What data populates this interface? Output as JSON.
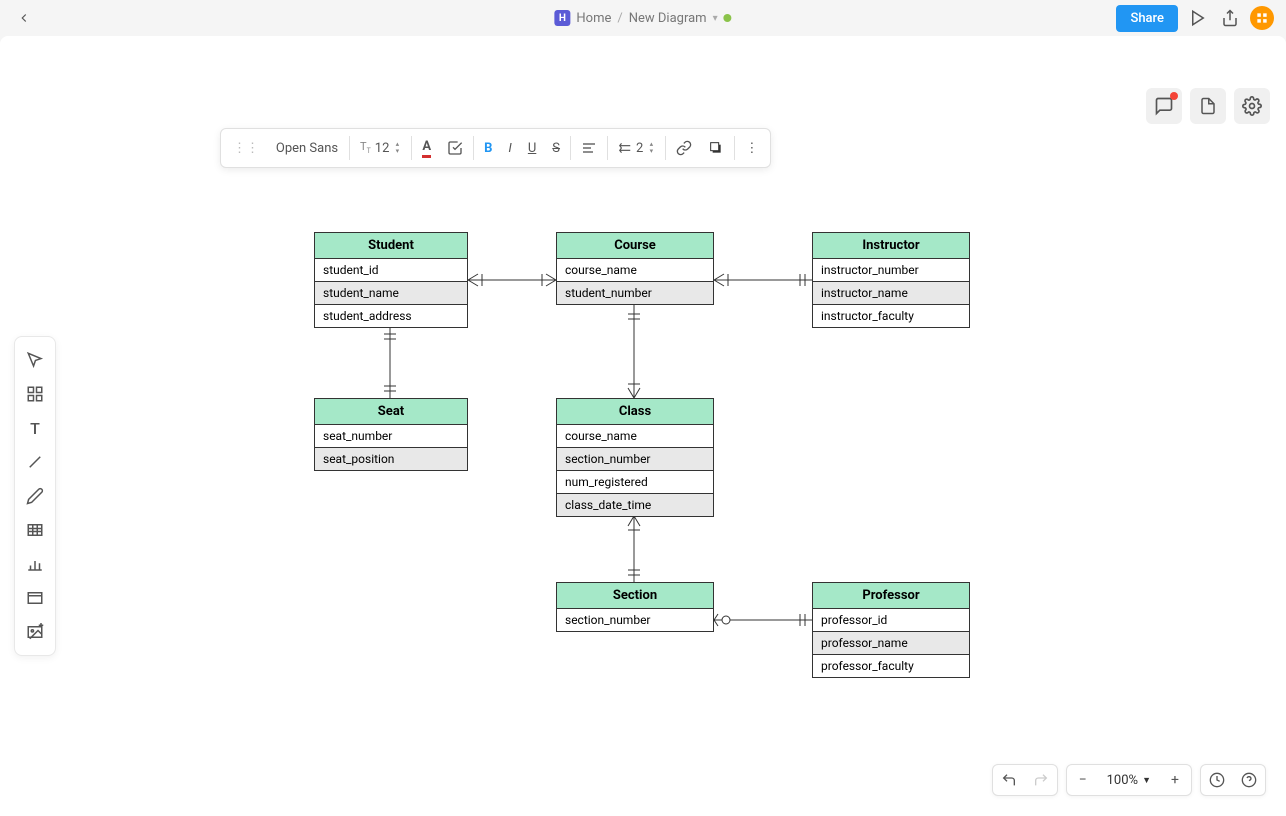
{
  "breadcrumb": {
    "home": "Home",
    "sep": "/",
    "current": "New Diagram",
    "badge": "H"
  },
  "topbar": {
    "share": "Share"
  },
  "format_toolbar": {
    "font": "Open Sans",
    "font_size": "12",
    "line_height": "2"
  },
  "zoom": {
    "level": "100%"
  },
  "entities": {
    "student": {
      "title": "Student",
      "rows": [
        "student_id",
        "student_name",
        "student_address"
      ]
    },
    "course": {
      "title": "Course",
      "rows": [
        "course_name",
        "student_number"
      ]
    },
    "instructor": {
      "title": "Instructor",
      "rows": [
        "instructor_number",
        "instructor_name",
        "instructor_faculty"
      ]
    },
    "seat": {
      "title": "Seat",
      "rows": [
        "seat_number",
        "seat_position"
      ]
    },
    "class": {
      "title": "Class",
      "rows": [
        "course_name",
        "section_number",
        "num_registered",
        "class_date_time"
      ]
    },
    "section": {
      "title": "Section",
      "rows": [
        "section_number"
      ]
    },
    "professor": {
      "title": "Professor",
      "rows": [
        "professor_id",
        "professor_name",
        "professor_faculty"
      ]
    }
  }
}
